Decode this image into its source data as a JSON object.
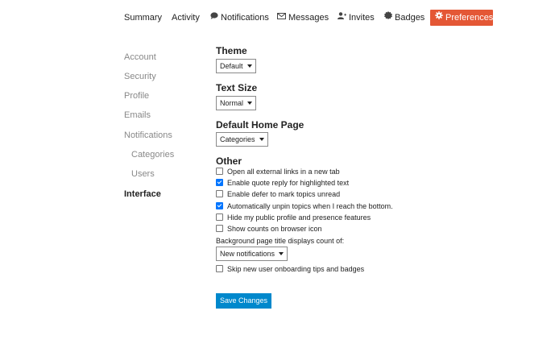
{
  "nav": {
    "summary": "Summary",
    "activity": "Activity",
    "notifications": "Notifications",
    "messages": "Messages",
    "invites": "Invites",
    "badges": "Badges",
    "preferences": "Preferences",
    "active_color": "#e45735"
  },
  "sidebar": {
    "items": [
      {
        "label": "Account"
      },
      {
        "label": "Security"
      },
      {
        "label": "Profile"
      },
      {
        "label": "Emails"
      },
      {
        "label": "Notifications"
      },
      {
        "label": "Categories"
      },
      {
        "label": "Users"
      },
      {
        "label": "Interface"
      }
    ]
  },
  "theme": {
    "heading": "Theme",
    "value": "Default"
  },
  "text_size": {
    "heading": "Text Size",
    "value": "Normal"
  },
  "home_page": {
    "heading": "Default Home Page",
    "value": "Categories"
  },
  "other": {
    "heading": "Other",
    "options": [
      {
        "label": "Open all external links in a new tab",
        "checked": false
      },
      {
        "label": "Enable quote reply for highlighted text",
        "checked": true
      },
      {
        "label": "Enable defer to mark topics unread",
        "checked": false
      },
      {
        "label": "Automatically unpin topics when I reach the bottom.",
        "checked": true
      },
      {
        "label": "Hide my public profile and presence features",
        "checked": false
      },
      {
        "label": "Show counts on browser icon",
        "checked": false
      }
    ],
    "bg_title_label": "Background page title displays count of:",
    "bg_title_value": "New notifications",
    "skip_onboarding": {
      "label": "Skip new user onboarding tips and badges",
      "checked": false
    }
  },
  "save_label": "Save Changes",
  "accent_color": "#0088cc"
}
